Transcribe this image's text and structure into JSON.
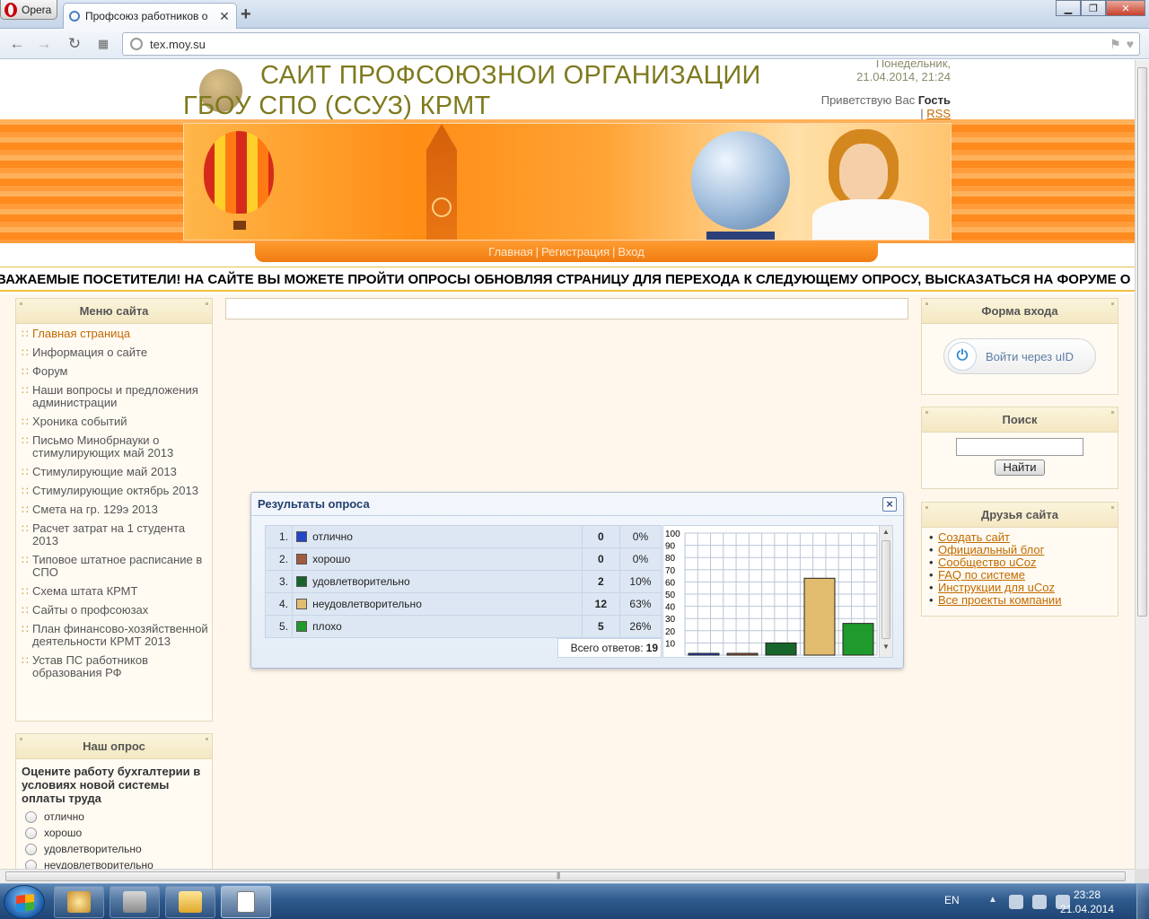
{
  "browser": {
    "menu_label": "Opera",
    "tab_title": "Профсоюз работников о",
    "url": "tex.moy.su"
  },
  "site": {
    "title": "САИТ ПРОФСОЮЗНОИ ОРГАНИЗАЦИИ ГБОУ СПО (ССУЗ) КРМТ",
    "day": "Понедельник,",
    "datetime": "21.04.2014, 21:24",
    "greeting_prefix": "Приветствую Вас",
    "greeting_user": "Гость",
    "rss_sep": "|",
    "rss": "RSS",
    "nav": [
      "Главная",
      "Регистрация",
      "Вход"
    ],
    "nav_sep": "|",
    "marquee": "ВАЖАЕМЫЕ ПОСЕТИТЕЛИ! НА САЙТЕ ВЫ МОЖЕТЕ ПРОЙТИ ОПРОСЫ ОБНОВЛЯЯ СТРАНИЦУ ДЛЯ ПЕРЕХОДА К СЛЕДУЮЩЕМУ ОПРОСУ, ВЫСКАЗАТЬСЯ НА ФОРУМЕ О"
  },
  "site_menu": {
    "title": "Меню сайта",
    "items": [
      "Главная страница",
      "Информация о сайте",
      "Форум",
      "Наши вопросы и предложения администрации",
      "Хроника событий",
      "Письмо Минобрнауки о стимулирующих май 2013",
      "Стимулирующие май 2013",
      "Стимулирующие октябрь 2013",
      "Смета на гр. 129э 2013",
      "Расчет затрат на 1 студента 2013",
      "Типовое штатное расписание в СПО",
      "Схема штата КРМТ",
      "Сайты о профсоюзах",
      "План финансово-хозяйственной деятельности КРМТ 2013",
      "Устав ПС работников образования РФ"
    ]
  },
  "our_poll": {
    "title": "Наш опрос",
    "question": "Оцените работу бухгалтерии в условиях новой системы оплаты труда",
    "options": [
      "отлично",
      "хорошо",
      "удовлетворительно",
      "неудовлетворительно"
    ]
  },
  "login": {
    "title": "Форма входа",
    "uid_button": "Войти через uID"
  },
  "search": {
    "title": "Поиск",
    "button": "Найти"
  },
  "friends": {
    "title": "Друзья сайта",
    "links": [
      "Создать сайт",
      "Официальный блог",
      "Сообщество uCoz",
      "FAQ по системе",
      "Инструкции для uCoz",
      "Все проекты компании"
    ]
  },
  "poll_results": {
    "title": "Результаты опроса",
    "close_label": "×",
    "rows": [
      {
        "num": "1.",
        "answer": "отлично",
        "count": "0",
        "percent": "0%",
        "color": "#2346c8"
      },
      {
        "num": "2.",
        "answer": "хорошо",
        "count": "0",
        "percent": "0%",
        "color": "#a05a3c"
      },
      {
        "num": "3.",
        "answer": "удовлетворительно",
        "count": "2",
        "percent": "10%",
        "color": "#17652a"
      },
      {
        "num": "4.",
        "answer": "неудовлетворительно",
        "count": "12",
        "percent": "63%",
        "color": "#e2bc6e"
      },
      {
        "num": "5.",
        "answer": "плохо",
        "count": "5",
        "percent": "26%",
        "color": "#1f9a2c"
      }
    ],
    "total_label": "Всего ответов:",
    "total": "19"
  },
  "chart_data": {
    "type": "bar",
    "categories": [
      "отлично",
      "хорошо",
      "удовлетворительно",
      "неудовлетворительно",
      "плохо"
    ],
    "values": [
      0,
      0,
      10,
      63,
      26
    ],
    "colors": [
      "#2346c8",
      "#a05a3c",
      "#17652a",
      "#e2bc6e",
      "#1f9a2c"
    ],
    "yticks": [
      10,
      20,
      30,
      40,
      50,
      60,
      70,
      80,
      90,
      100
    ],
    "ylim": [
      0,
      100
    ],
    "grid": true
  },
  "taskbar": {
    "lang": "EN",
    "time": "23:28",
    "date": "21.04.2014"
  }
}
